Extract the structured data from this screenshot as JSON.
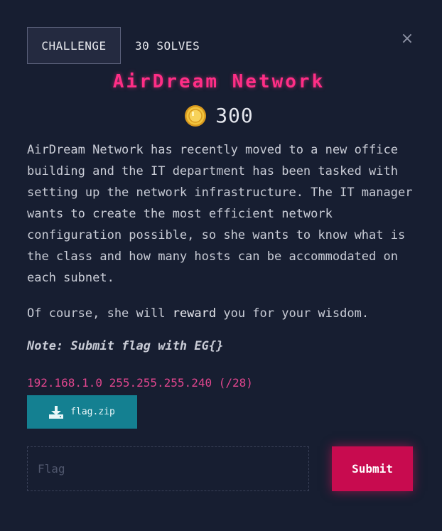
{
  "tabs": {
    "challenge_label": "CHALLENGE",
    "solves_label": "30 SOLVES"
  },
  "close_glyph": "×",
  "challenge": {
    "title": "AirDream Network",
    "points": "300",
    "description_1": "AirDream Network has recently moved to a new office building and the IT department has been tasked with setting up the network infrastructure. The IT manager wants to create the most efficient network configuration possible, so she wants to know what is the class and how many hosts can be accommodated on each subnet.",
    "description_2_before": "Of course, she will ",
    "description_2_bold": "reward",
    "description_2_after": " you for your wisdom.",
    "note": "Note: Submit flag with EG{}",
    "hint": "192.168.1.0 255.255.255.240 (/28)"
  },
  "file": {
    "name": "flag.zip",
    "icon": "download-icon"
  },
  "form": {
    "flag_placeholder": "Flag",
    "flag_value": "",
    "submit_label": "Submit"
  },
  "colors": {
    "background": "#171e31",
    "title": "#ff2e86",
    "hint": "#e0468e",
    "file_button": "#148091",
    "submit_button": "#c80b4f",
    "coin": "#f2c43d"
  }
}
